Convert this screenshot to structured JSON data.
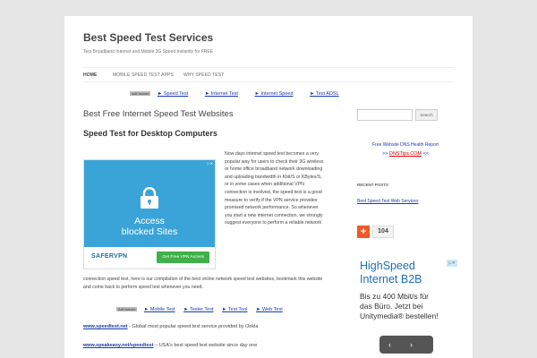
{
  "site": {
    "title": "Best Speed Test Services",
    "description": "Test Broadband Internet and Mobile 3G Speed Instantly for FREE"
  },
  "nav": {
    "items": [
      "HOME",
      "MOBILE SPEED TEST APPS",
      "WHY SPEED TEST"
    ]
  },
  "ad_links_top": {
    "adchoices": "AdChoices",
    "links": [
      "► Speed Test",
      "► Internet Test",
      "► Internet Speed",
      "► Test ADSL"
    ]
  },
  "post": {
    "title": "Best Free Internet Speed Test Websites",
    "heading": "Speed Test for Desktop Computers",
    "paragraph_side": "Now days internet speed test becomes a very popular way for users to check their 3G wireless or home office broadband network downloading and uploading bandwidth in Kbit/S or KBytes/S, or in some cases when additional VPN connection is involved, the speed test is a good measure to verify if the VPN service provides promised network performance. So whenever you start a new internet connection, we strongly suggest everyone to perform a reliable network",
    "paragraph_full": "connection speed test, here is our compilation of the best online network speed test websites, bookmark this website and come back to perform speed test whenever you need."
  },
  "ad_box": {
    "text_line1": "Access",
    "text_line2": "blocked Sites",
    "brand": "SAFERVPN",
    "cta": "Get Free VPN Access",
    "corner": "▷✕",
    "icon": "lock-icon"
  },
  "ad_links_bottom": {
    "adchoices": "AdChoices",
    "links": [
      "► Mobile Test",
      "► Tester Test",
      "► Test Tool",
      "► Web Test"
    ]
  },
  "site_links": [
    {
      "url": "www.speedtest.net",
      "text": " - Global most popular speed test service provided by Ookla"
    },
    {
      "url": "www.speakeasy.net/speedtest",
      "text": " – USA's best speed test website since day one"
    }
  ],
  "sidebar": {
    "search_button": "Search",
    "dns_title": "Free Website DNS Health Report",
    "dns_prefix": ">> ",
    "dns_link": "DNSTips.COM",
    "dns_suffix": " <<",
    "recent_title": "RECENT POSTS",
    "recent_link": "Best Speed Test Web Services",
    "share_plus": "+",
    "share_count": "104",
    "ad_head_line1": "HighSpeed",
    "ad_head_line2": "Internet B2B",
    "ad_body_line1": "Bis zu 400 Mbit/s für",
    "ad_body_line2": "das Büro. Jetzt bei",
    "ad_body_line3": "Unitymedia® bestellen!",
    "ad_corner": "▷✕",
    "ad_prev": "‹",
    "ad_next": "›"
  },
  "colors": {
    "link": "#1a3ab0",
    "ad_blue": "#3aa4d9",
    "cta_green": "#3fb14a",
    "share_orange": "#f05a28"
  }
}
